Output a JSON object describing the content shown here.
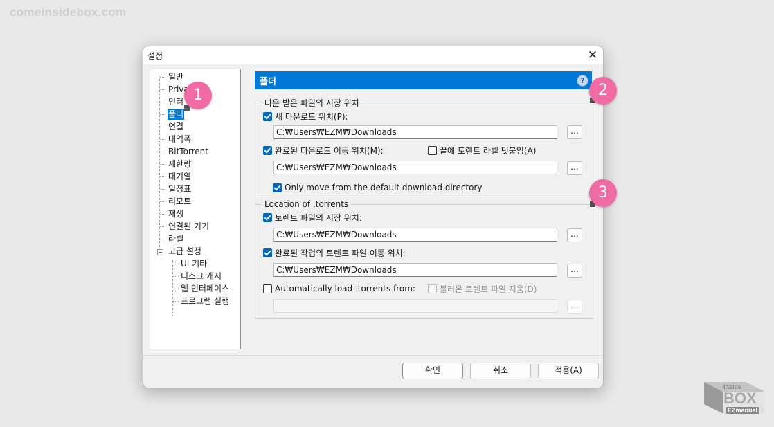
{
  "watermark": {
    "site": "comeinsidebox.com",
    "logo_top": "Inside",
    "logo_main": "BOX",
    "logo_sub": "EZmanual"
  },
  "dialog": {
    "title": "설정"
  },
  "tree": {
    "items": [
      {
        "label": "일반"
      },
      {
        "label": "Priva"
      },
      {
        "label": "인터"
      },
      {
        "label": "폴더",
        "selected": true
      },
      {
        "label": "연결"
      },
      {
        "label": "대역폭"
      },
      {
        "label": "BitTorrent"
      },
      {
        "label": "제한량"
      },
      {
        "label": "대기열"
      },
      {
        "label": "일정표"
      },
      {
        "label": "리모트"
      },
      {
        "label": "재생"
      },
      {
        "label": "연결된 기기"
      },
      {
        "label": "라벨"
      },
      {
        "label": "고급 설정"
      }
    ],
    "children": [
      {
        "label": "UI 기타"
      },
      {
        "label": "디스크 캐시"
      },
      {
        "label": "웹 인터페이스"
      },
      {
        "label": "프로그램 실행"
      }
    ]
  },
  "panel": {
    "title": "폴더",
    "help": "?"
  },
  "download_group": {
    "legend": "다운 받은 파일의 저장 위치",
    "new_download_label": "새 다운로드 위치(P):",
    "new_download_checked": true,
    "new_download_path": "C:₩Users₩EZM₩Downloads",
    "move_completed_label": "완료된 다운로드 이동 위치(M):",
    "move_completed_checked": true,
    "append_label_label": "끝에 토렌트 라벨 덧붙임(A)",
    "append_label_checked": false,
    "move_completed_path": "C:₩Users₩EZM₩Downloads",
    "only_move_label": "Only move from the default download directory",
    "only_move_checked": true
  },
  "torrents_group": {
    "legend": "Location of .torrents",
    "store_label": "토렌트 파일의 저장 위치:",
    "store_checked": true,
    "store_path": "C:₩Users₩EZM₩Downloads",
    "move_finished_label": "완료된 작업의 토렌트 파일 이동 위치:",
    "move_finished_checked": true,
    "move_finished_path": "C:₩Users₩EZM₩Downloads",
    "auto_load_label": "Automatically load .torrents from:",
    "auto_load_checked": false,
    "delete_loaded_label": "불러온 토렌트 파일 지움(D)",
    "delete_loaded_checked": false,
    "auto_load_path": ""
  },
  "browse_label": "...",
  "buttons": {
    "ok": "확인",
    "cancel": "취소",
    "apply": "적용(A)"
  },
  "markers": [
    "1",
    "2",
    "3"
  ],
  "colors": {
    "accent": "#0078d7",
    "marker": "#f06aa3"
  }
}
